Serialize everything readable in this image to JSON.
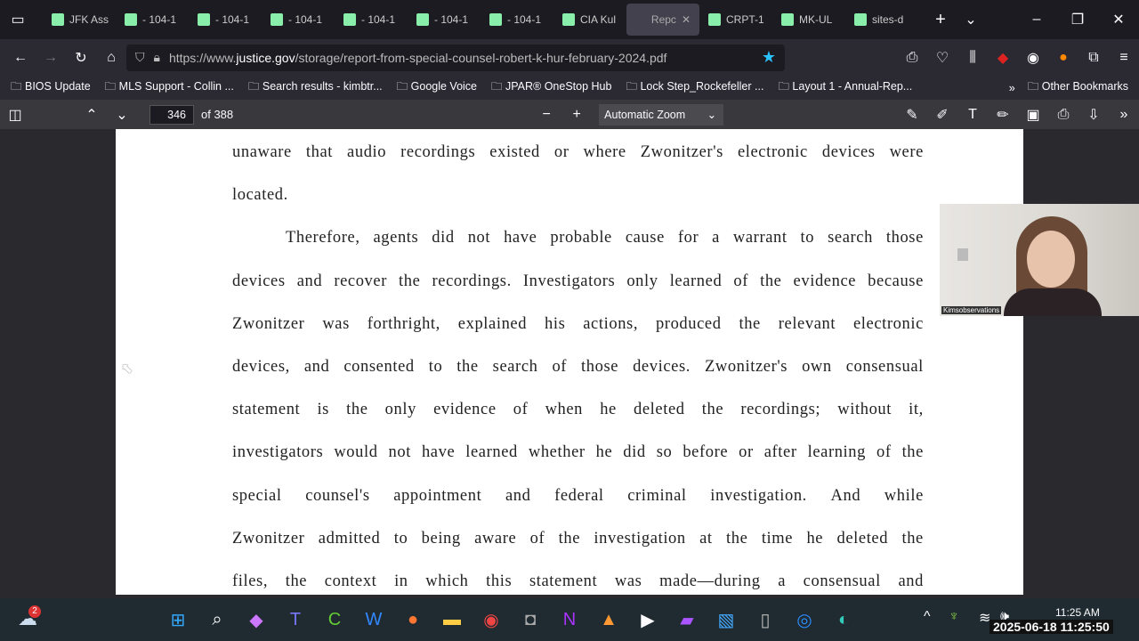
{
  "tabs": [
    {
      "label": "JFK Ass"
    },
    {
      "label": "- 104-1"
    },
    {
      "label": "- 104-1"
    },
    {
      "label": "- 104-1"
    },
    {
      "label": "- 104-1"
    },
    {
      "label": "- 104-1"
    },
    {
      "label": "- 104-1"
    },
    {
      "label": "CIA Kul"
    },
    {
      "label": "Repc",
      "active": true
    },
    {
      "label": "CRPT-1"
    },
    {
      "label": "MK-UL"
    },
    {
      "label": "sites-d"
    }
  ],
  "url": {
    "prefix": "https://www.",
    "domain": "justice.gov",
    "path": "/storage/report-from-special-counsel-robert-k-hur-february-2024.pdf"
  },
  "bookmarks": [
    "BIOS Update",
    "MLS Support - Collin ...",
    "Search results - kimbtr...",
    "Google Voice",
    "JPAR® OneStop Hub",
    "Lock Step_Rockefeller ...",
    "Layout 1 - Annual-Rep..."
  ],
  "other_bookmarks": "Other Bookmarks",
  "pdf": {
    "page": "346",
    "of": "of 388",
    "zoom": "Automatic Zoom"
  },
  "lines": [
    "unaware that audio recordings existed or where Zwonitzer's electronic devices were",
    "located.",
    "Therefore, agents did not have probable cause for a warrant to search those",
    "devices and recover the recordings. Investigators only learned of the evidence because",
    "Zwonitzer was forthright, explained his actions, produced the relevant electronic",
    "devices, and consented to the search of those devices. Zwonitzer's own consensual",
    "statement is the only evidence of when he deleted the recordings; without it,",
    "investigators would not have learned whether he did so before or after learning of the",
    "special counsel's appointment and federal criminal investigation. And while",
    "Zwonitzer admitted to being aware of the investigation at the time he deleted the",
    "files, the context in which this statement was made—during a consensual and"
  ],
  "webcam": {
    "label": "Kimsobservations"
  },
  "taskbar": {
    "badge": "2",
    "time": "11:25 AM",
    "timestamp": "2025-06-18 11:25:50"
  }
}
